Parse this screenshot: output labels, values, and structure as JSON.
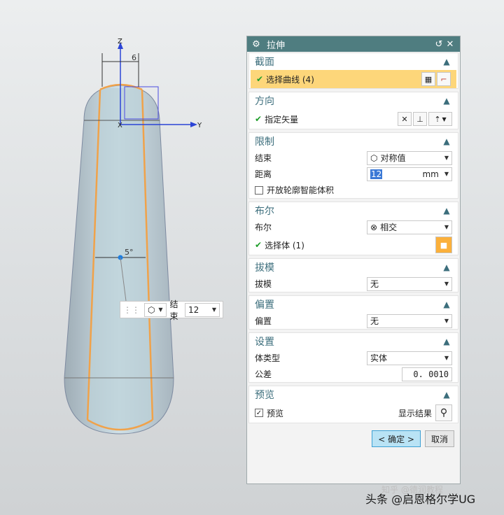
{
  "viewport": {
    "axes": {
      "z": "Z",
      "y": "Y",
      "x": "X"
    },
    "dims": {
      "top": "6",
      "mid": "5°"
    },
    "onscreen_panel": {
      "label": "结束",
      "value": "12"
    }
  },
  "dialog": {
    "title": "拉伸",
    "sections": {
      "section": {
        "title": "截面",
        "select_curve": "选择曲线 (4)"
      },
      "direction": {
        "title": "方向",
        "vector": "指定矢量"
      },
      "limits": {
        "title": "限制",
        "end_label": "结束",
        "end_value": "对称值",
        "dist_label": "距离",
        "dist_value": "12",
        "dist_unit": "mm",
        "open_profile": "开放轮廓智能体积"
      },
      "boolean": {
        "title": "布尔",
        "label": "布尔",
        "value": "相交",
        "select_body": "选择体 (1)"
      },
      "draft": {
        "title": "拔模",
        "label": "拔模",
        "value": "无"
      },
      "offset": {
        "title": "偏置",
        "label": "偏置",
        "value": "无"
      },
      "settings": {
        "title": "设置",
        "body_label": "体类型",
        "body_value": "实体",
        "tol_label": "公差",
        "tol_value": "0. 0010"
      },
      "preview": {
        "title": "预览",
        "preview_label": "预览",
        "show_result": "显示结果"
      }
    },
    "buttons": {
      "ok": "< 确定 >",
      "cancel": "取消"
    }
  },
  "watermark": {
    "main": "头条 @启恩格尔学UG",
    "faint": "知乎 @德润教程"
  }
}
